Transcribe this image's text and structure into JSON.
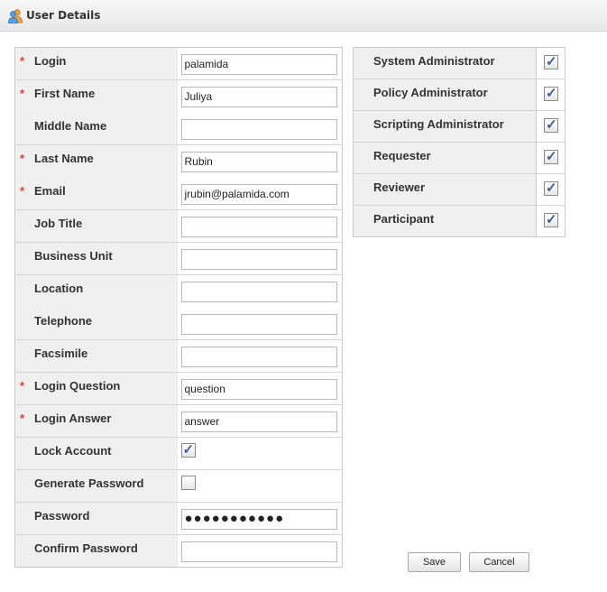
{
  "window": {
    "title": "User Details"
  },
  "fields": [
    {
      "label": "Login",
      "required": true,
      "type": "text",
      "value": "palamida"
    },
    {
      "label": "First Name",
      "required": true,
      "type": "text",
      "value": "Juliya"
    },
    {
      "label": "Middle Name",
      "required": false,
      "type": "text",
      "value": ""
    },
    {
      "label": "Last Name",
      "required": true,
      "type": "text",
      "value": "Rubin"
    },
    {
      "label": "Email",
      "required": true,
      "type": "text",
      "value": "jrubin@palamida.com"
    },
    {
      "label": "Job Title",
      "required": false,
      "type": "text",
      "value": ""
    },
    {
      "label": "Business Unit",
      "required": false,
      "type": "text",
      "value": ""
    },
    {
      "label": "Location",
      "required": false,
      "type": "text",
      "value": ""
    },
    {
      "label": "Telephone",
      "required": false,
      "type": "text",
      "value": ""
    },
    {
      "label": "Facsimile",
      "required": false,
      "type": "text",
      "value": ""
    },
    {
      "label": "Login Question",
      "required": true,
      "type": "text",
      "value": "question"
    },
    {
      "label": "Login Answer",
      "required": true,
      "type": "text",
      "value": "answer"
    },
    {
      "label": "Lock Account",
      "required": false,
      "type": "checkbox",
      "checked": true
    },
    {
      "label": "Generate Password",
      "required": false,
      "type": "checkbox",
      "checked": false
    },
    {
      "label": "Password",
      "required": false,
      "type": "password",
      "value": "●●●●●●●●●●●"
    },
    {
      "label": "Confirm Password",
      "required": false,
      "type": "password",
      "value": ""
    }
  ],
  "roles": [
    {
      "label": "System Administrator",
      "checked": true
    },
    {
      "label": "Policy Administrator",
      "checked": true
    },
    {
      "label": "Scripting Administrator",
      "checked": true
    },
    {
      "label": "Requester",
      "checked": true
    },
    {
      "label": "Reviewer",
      "checked": true
    },
    {
      "label": "Participant",
      "checked": true
    }
  ],
  "buttons": {
    "save": "Save",
    "cancel": "Cancel"
  },
  "required_marker": "*",
  "check_glyph": "✓",
  "colors": {
    "required": "#e13b3b",
    "check": "#3c5f9e",
    "label_bg": "#efefef"
  },
  "icons": {
    "title": "users-icon"
  }
}
